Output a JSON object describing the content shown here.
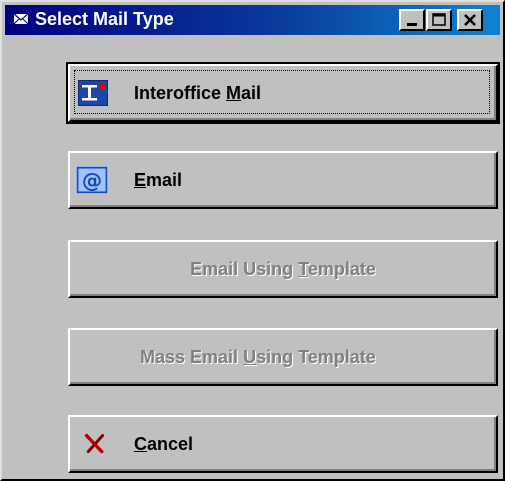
{
  "window": {
    "title": "Select Mail Type",
    "title_icon": "envelope-icon",
    "controls": [
      "minimize-icon",
      "maximize-icon",
      "close-icon"
    ]
  },
  "buttons": [
    {
      "id": "interoffice",
      "pre": "Interoffice ",
      "hot": "M",
      "post": "ail",
      "icon": "interoffice-mail-icon",
      "enabled": true,
      "default": true
    },
    {
      "id": "email",
      "pre": "",
      "hot": "E",
      "post": "mail",
      "icon": "at-sign-icon",
      "enabled": true
    },
    {
      "id": "email-template",
      "pre": "Email Using ",
      "hot": "T",
      "post": "emplate",
      "enabled": false
    },
    {
      "id": "mass-email",
      "pre": "Mass Email ",
      "hot": "U",
      "post": "sing Template",
      "enabled": false
    },
    {
      "id": "cancel",
      "pre": "",
      "hot": "C",
      "post": "ancel",
      "icon": "red-x-icon",
      "enabled": true
    }
  ],
  "colors": {
    "face": "#c0c0c0",
    "titlebar_start": "#000080",
    "titlebar_end": "#1084d0",
    "disabled_text": "#808080",
    "cancel_x": "#c00000"
  }
}
